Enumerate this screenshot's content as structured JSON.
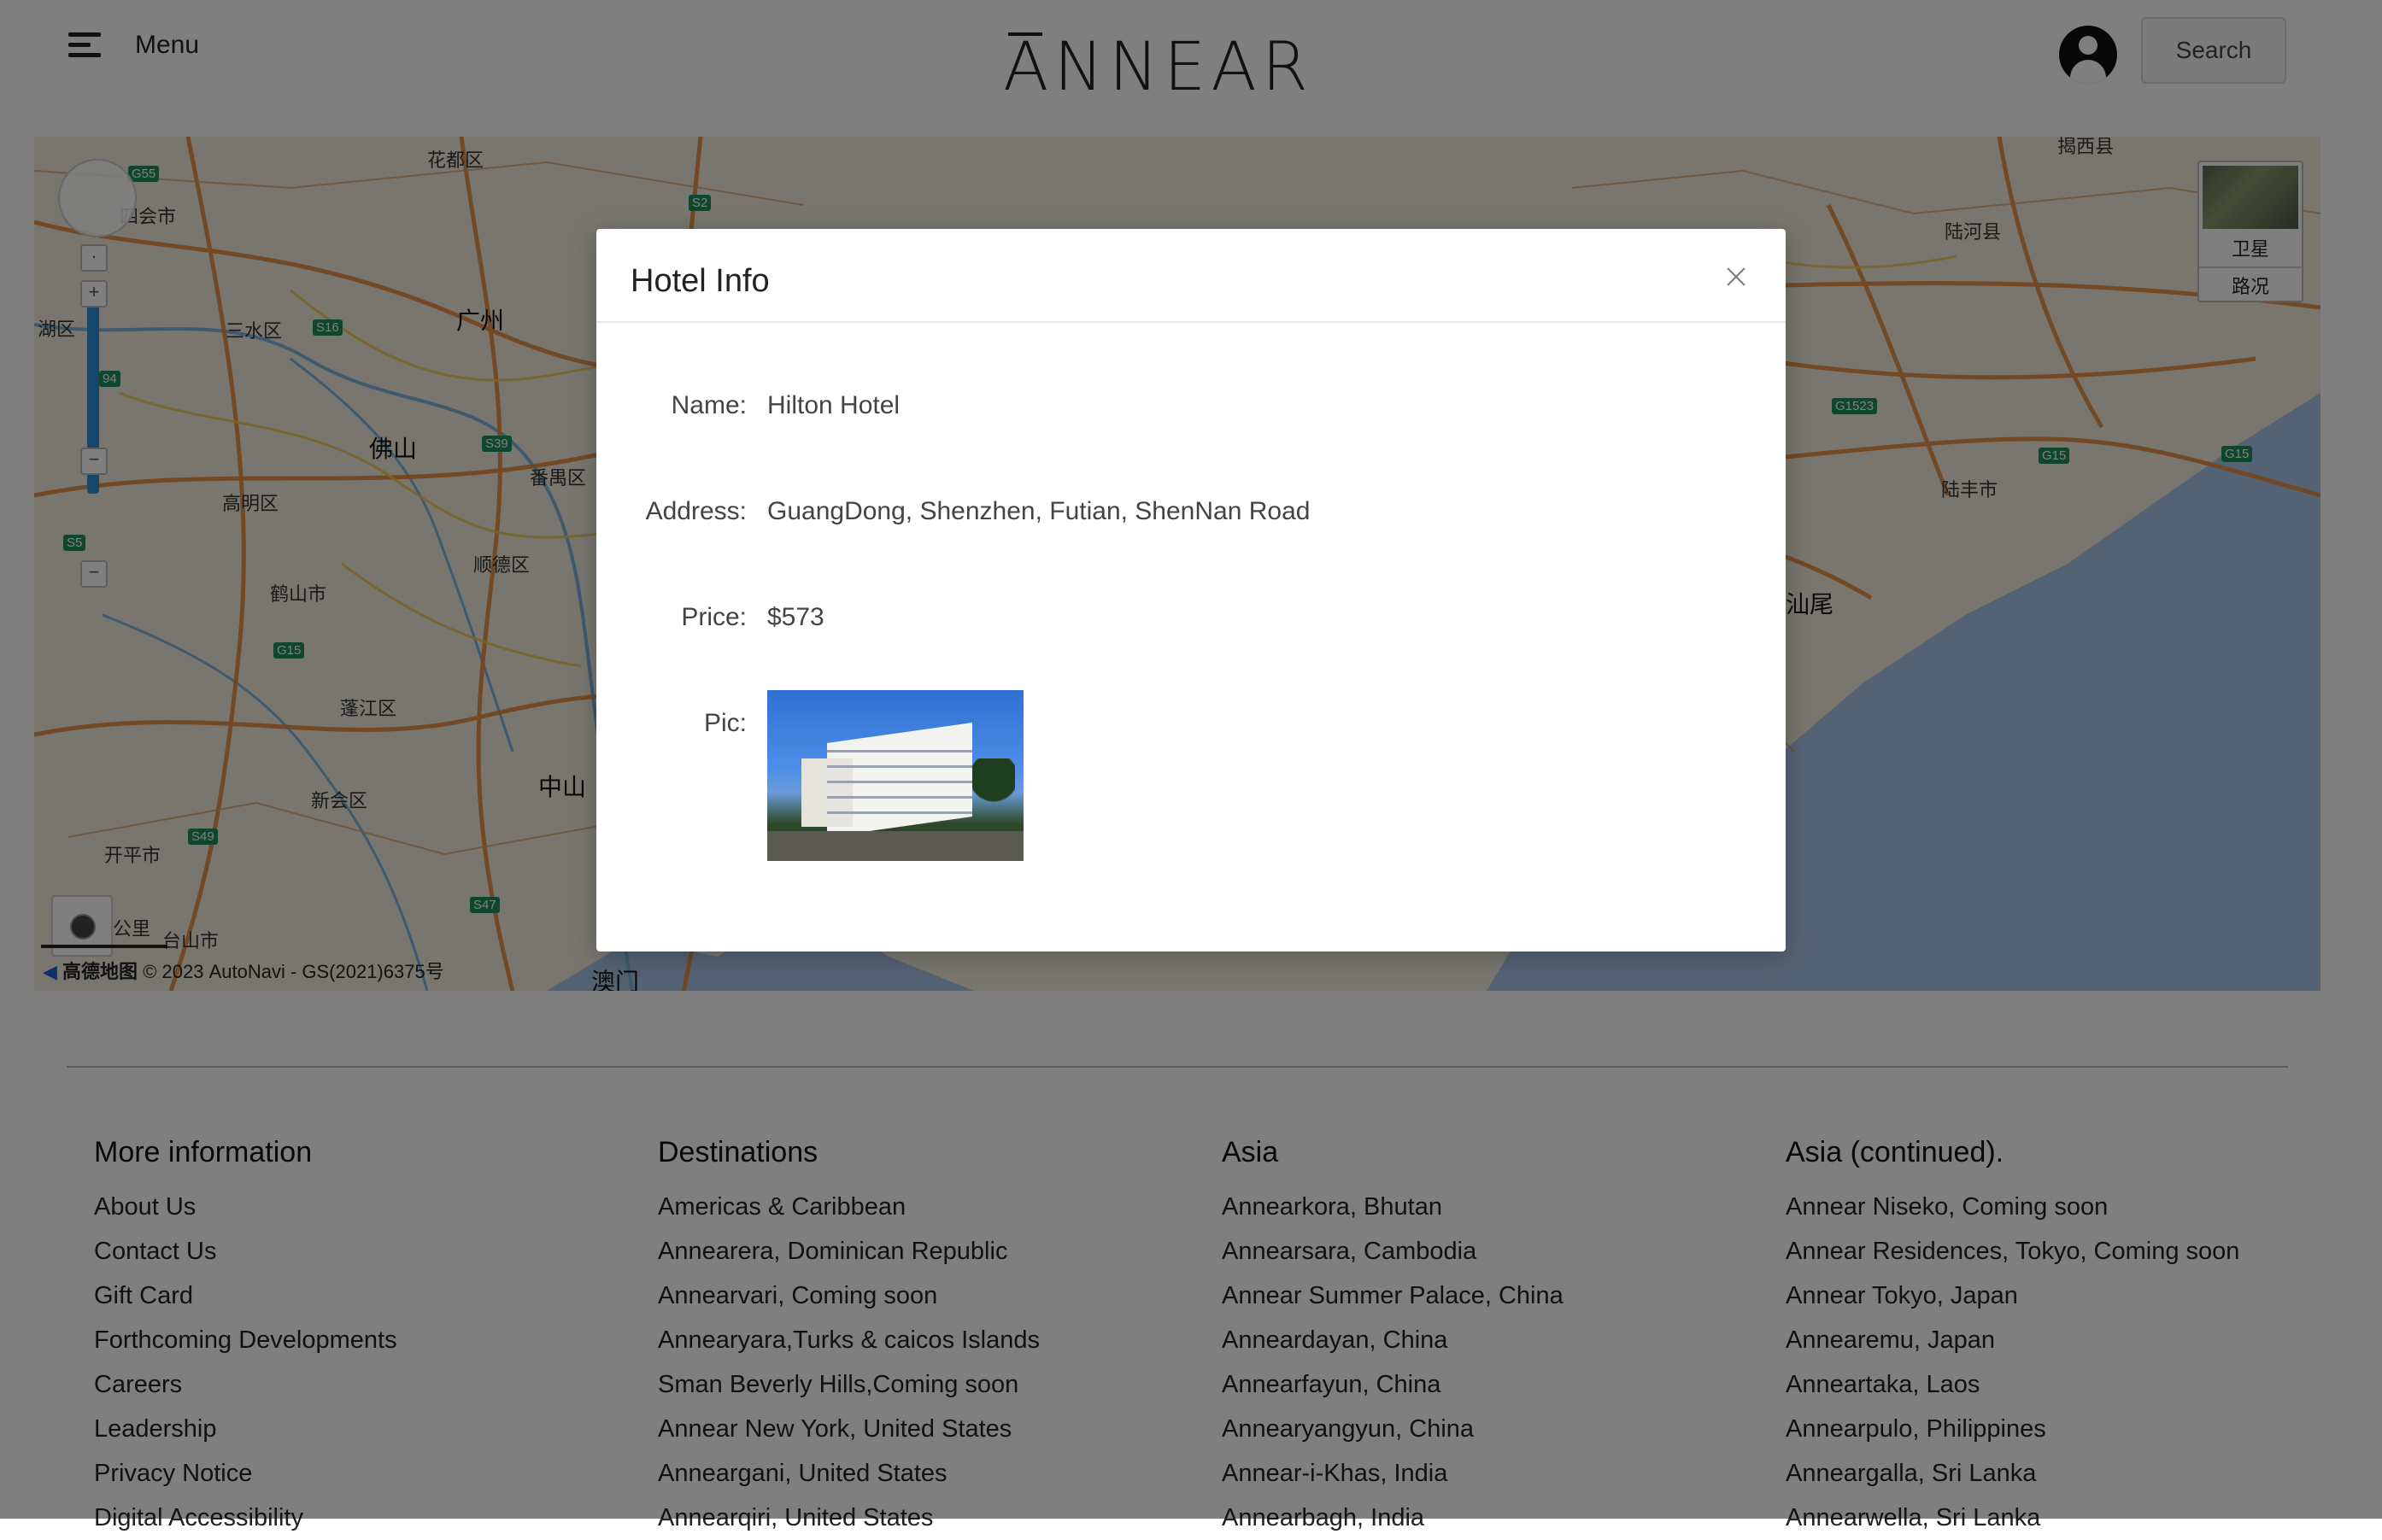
{
  "header": {
    "menu_label": "Menu",
    "logo": "ANNEAR",
    "search_label": "Search"
  },
  "map": {
    "cities": [
      "广州",
      "佛山",
      "中山",
      "澳门",
      "汕尾"
    ],
    "districts": [
      "花都区",
      "四会市",
      "三水区",
      "湖区",
      "高明区",
      "鹤山市",
      "番禺区",
      "顺德区",
      "蓬江区",
      "新会区",
      "开平市",
      "台山市",
      "陆河县",
      "陆丰市",
      "揭西县"
    ],
    "highways": [
      "G55",
      "S2",
      "S16",
      "S39",
      "S5",
      "G15",
      "S49",
      "S47",
      "G1523",
      "G15",
      "G15",
      "94"
    ],
    "satellite_label": "卫星",
    "traffic_label": "路况",
    "scale_label": "公里",
    "copyright": "© 2023 AutoNavi - GS(2021)6375号",
    "brand": "高德地图"
  },
  "modal": {
    "title": "Hotel Info",
    "fields": {
      "name_label": "Name:",
      "name_value": "Hilton Hotel",
      "address_label": "Address:",
      "address_value": "GuangDong, Shenzhen, Futian, ShenNan Road",
      "price_label": "Price:",
      "price_value": "$573",
      "pic_label": "Pic:"
    }
  },
  "footer": {
    "columns": [
      {
        "title": "More information",
        "items": [
          "About Us",
          "Contact Us",
          "Gift Card",
          "Forthcoming Developments",
          "Careers",
          "Leadership",
          "Privacy Notice",
          "Digital Accessibility"
        ]
      },
      {
        "title": "Destinations",
        "items": [
          "Americas & Caribbean",
          "Annearera, Dominican Republic",
          "Annearvari, Coming soon",
          "Annearyara,Turks & caicos Islands",
          "Sman Beverly Hills,Coming soon",
          "Annear New York, United States",
          "Anneargani, United States",
          "Annearqiri, United States"
        ]
      },
      {
        "title": "Asia",
        "items": [
          "Annearkora, Bhutan",
          "Annearsara, Cambodia",
          "Annear Summer Palace, China",
          "Anneardayan, China",
          "Annearfayun, China",
          "Annearyangyun, China",
          "Annear-i-Khas, India",
          "Annearbagh, India"
        ]
      },
      {
        "title": "Asia (continued).",
        "items": [
          "Annear Niseko, Coming soon",
          "Annear Residences, Tokyo, Coming soon",
          "Annear Tokyo, Japan",
          "Annearemu, Japan",
          "Anneartaka, Laos",
          "Annearpulo, Philippines",
          "Anneargalla, Sri Lanka",
          "Annearwella, Sri Lanka"
        ]
      }
    ]
  }
}
